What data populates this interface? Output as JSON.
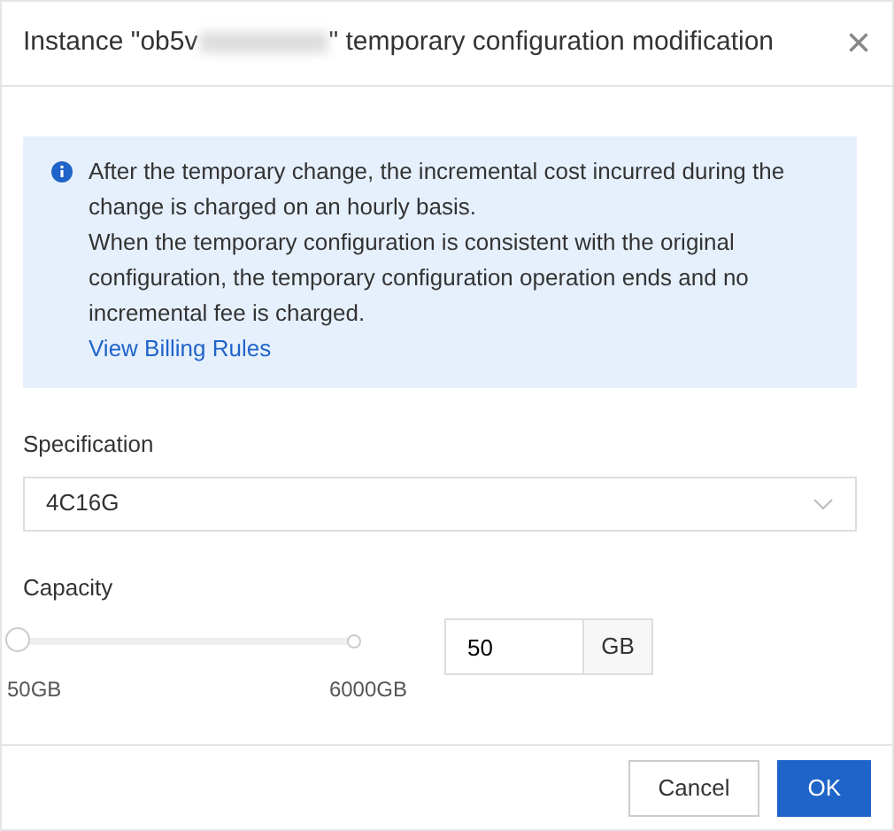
{
  "dialog": {
    "title_start": "Instance \"ob5v",
    "title_end": "\" temporary configuration modification",
    "close": "×"
  },
  "notice": {
    "lines": [
      "After the temporary change, the incremental cost incurred during the change is charged on an hourly basis.",
      "When the temporary configuration is consistent with the original configuration, the temporary configuration operation ends and no incremental fee is charged."
    ],
    "link": "View Billing Rules"
  },
  "specification": {
    "label": "Specification",
    "value": "4C16G"
  },
  "capacity": {
    "label": "Capacity",
    "level": 0,
    "min_label": "50GB",
    "max_label": "6000GB",
    "value": "50",
    "unit": "GB"
  },
  "buttons": [
    {
      "label": "Cancel",
      "kind": "secondary"
    },
    {
      "label": "OK",
      "kind": "primary"
    }
  ]
}
